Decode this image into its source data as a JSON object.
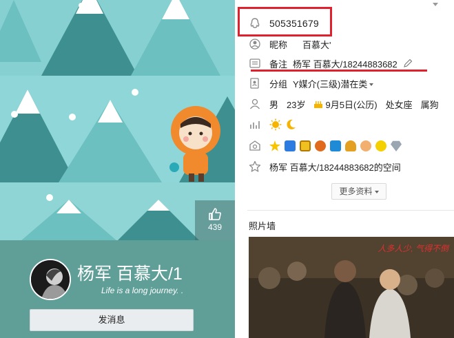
{
  "profile": {
    "display_name": "杨军 百慕大/1",
    "signature": "Life is a long journey. .",
    "likes": "439",
    "message_button": "发消息"
  },
  "info": {
    "qq_number": "505351679",
    "nickname_label": "昵称",
    "nickname_value": "百慕大'",
    "remark_label": "备注",
    "remark_value": "杨军 百慕大/18244883682",
    "group_label": "分组",
    "group_value": "Y媒介(三级)潜在类",
    "gender": "男",
    "age": "23岁",
    "birthday": "9月5日(公历)",
    "zodiac": "处女座",
    "chinese_zodiac": "属狗",
    "space_link": "杨军 百慕大/18244883682的空间",
    "more_button": "更多资料",
    "photo_wall_title": "照片墙",
    "photo_caption": "人多人少, 气得不倒"
  },
  "colors": {
    "sky": "#8fd5d6",
    "tree_dark": "#3e8f8f",
    "tree_light": "#6cc0c0",
    "highlight_red": "#e0202c",
    "bottom_panel": "#5f9f98"
  },
  "icons": [
    "qq-icon",
    "nickname-icon",
    "remark-icon",
    "group-icon",
    "person-icon",
    "level-icon",
    "badge-icon",
    "star-icon",
    "thumb-up-icon",
    "pencil-icon",
    "birthday-icon"
  ]
}
